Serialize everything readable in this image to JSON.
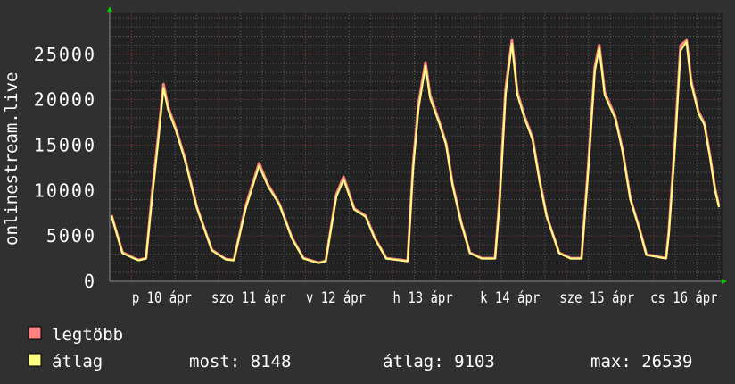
{
  "chart_data": {
    "type": "line",
    "ylabel": "onlinestream.live",
    "xlim": [
      "04-09 18:00",
      "04-16 18:00"
    ],
    "ylim": [
      0,
      29600
    ],
    "grid": true,
    "y_ticks": [
      0,
      5000,
      10000,
      15000,
      20000,
      25000
    ],
    "y_tick_labels": [
      "0",
      "5000",
      "10000",
      "15000",
      "20000",
      "25000"
    ],
    "x_ticks": [
      "04-10 00:00",
      "04-11 00:00",
      "04-12 00:00",
      "04-13 00:00",
      "04-14 00:00",
      "04-15 00:00",
      "04-16 00:00"
    ],
    "x_tick_labels": [
      "p 10 ápr",
      "szo 11 ápr",
      "v 12 ápr",
      "h 13 ápr",
      "k 14 ápr",
      "sze 15 ápr",
      "cs 16 ápr"
    ],
    "colors": {
      "background": "#303030",
      "plot": "#222222",
      "max": "#ff8080",
      "avg": "#ffff80",
      "grid_minor": "#5a5a5a",
      "grid_major": "#8a3a3a",
      "arrow": "#00cc00"
    },
    "x": [
      "04-09 18:30",
      "04-09 21:30",
      "04-10 00:45",
      "04-10 02:00",
      "04-10 04:00",
      "04-10 05:40",
      "04-10 07:20",
      "04-10 08:50",
      "04-10 10:05",
      "04-10 12:20",
      "04-10 14:45",
      "04-10 18:00",
      "04-10 22:10",
      "04-11 02:00",
      "04-11 04:15",
      "04-11 07:30",
      "04-11 11:10",
      "04-11 13:35",
      "04-11 16:50",
      "04-11 20:15",
      "04-11 23:25",
      "04-12 03:35",
      "04-12 05:35",
      "04-12 08:30",
      "04-12 10:30",
      "04-12 13:25",
      "04-12 16:35",
      "04-12 19:05",
      "04-12 22:15",
      "04-13 04:10",
      "04-13 05:40",
      "04-13 07:10",
      "04-13 09:05",
      "04-13 10:20",
      "04-13 13:00",
      "04-13 14:45",
      "04-13 16:30",
      "04-13 18:55",
      "04-13 21:20",
      "04-14 00:35",
      "04-14 04:15",
      "04-14 05:30",
      "04-14 07:10",
      "04-14 08:55",
      "04-14 10:25",
      "04-14 12:25",
      "04-14 14:35",
      "04-14 16:30",
      "04-14 18:30",
      "04-14 21:55",
      "04-15 01:05",
      "04-15 04:05",
      "04-15 06:00",
      "04-15 07:45",
      "04-15 09:00",
      "04-15 10:30",
      "04-15 13:25",
      "04-15 15:25",
      "04-15 17:35",
      "04-15 20:05",
      "04-15 22:00",
      "04-16 03:25",
      "04-16 04:10",
      "04-16 05:55",
      "04-16 07:25",
      "04-16 09:05",
      "04-16 10:20",
      "04-16 12:20",
      "04-16 14:00",
      "04-16 15:40",
      "04-16 16:55",
      "04-16 18:00"
    ],
    "series": [
      {
        "name": "legtöbb",
        "values": [
          7300,
          3200,
          2550,
          2350,
          2550,
          9600,
          15800,
          21700,
          19200,
          16700,
          13500,
          8200,
          3450,
          2450,
          2350,
          8300,
          13000,
          10700,
          8500,
          4800,
          2550,
          2050,
          2250,
          9600,
          11500,
          8000,
          7200,
          4800,
          2550,
          2250,
          12800,
          19600,
          24100,
          20500,
          17400,
          15200,
          10800,
          6500,
          3150,
          2550,
          2550,
          9000,
          21200,
          26539,
          20800,
          18100,
          15800,
          11200,
          7200,
          3150,
          2550,
          2550,
          12900,
          23600,
          26000,
          20800,
          18100,
          14500,
          9100,
          5800,
          2950,
          2550,
          5500,
          15700,
          26000,
          26539,
          22100,
          18700,
          17400,
          13500,
          10200,
          8300
        ]
      },
      {
        "name": "átlag",
        "values": [
          7200,
          3100,
          2500,
          2300,
          2500,
          9000,
          15200,
          21300,
          18900,
          16500,
          13300,
          8100,
          3400,
          2400,
          2300,
          8000,
          12700,
          10500,
          8400,
          4700,
          2500,
          2000,
          2200,
          9300,
          11200,
          7900,
          7100,
          4700,
          2500,
          2200,
          12300,
          19000,
          23700,
          20200,
          17200,
          15000,
          10600,
          6400,
          3100,
          2500,
          2500,
          8400,
          20500,
          26200,
          20500,
          17900,
          15600,
          11000,
          7100,
          3100,
          2500,
          2500,
          12300,
          23100,
          25700,
          20500,
          17900,
          14300,
          9000,
          5700,
          2900,
          2500,
          5100,
          15000,
          25400,
          26400,
          21800,
          18500,
          17200,
          13300,
          10000,
          8148
        ]
      }
    ],
    "legend": [
      {
        "label": "legtöbb",
        "color": "#ff8080"
      },
      {
        "label": "átlag",
        "color": "#ffff80"
      }
    ],
    "stats": {
      "now": "most: 8148",
      "avg": "átlag: 9103",
      "max": "max: 26539"
    }
  }
}
